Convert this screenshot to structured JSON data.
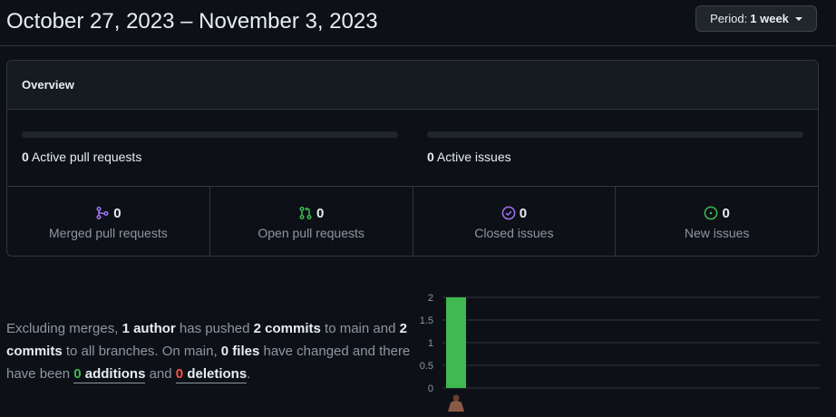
{
  "header": {
    "date_range": "October 27, 2023 – November 3, 2023",
    "period_prefix": "Period:",
    "period_value": "1 week"
  },
  "overview": {
    "title": "Overview",
    "active_pull_requests": {
      "count": "0",
      "label": "Active pull requests"
    },
    "active_issues": {
      "count": "0",
      "label": "Active issues"
    },
    "stats": [
      {
        "count": "0",
        "label": "Merged pull requests",
        "icon": "git-merge-icon",
        "color": "#a371f7"
      },
      {
        "count": "0",
        "label": "Open pull requests",
        "icon": "git-pull-request-icon",
        "color": "#3fb950"
      },
      {
        "count": "0",
        "label": "Closed issues",
        "icon": "issue-closed-icon",
        "color": "#a371f7"
      },
      {
        "count": "0",
        "label": "New issues",
        "icon": "issue-opened-icon",
        "color": "#3fb950"
      }
    ]
  },
  "summary": {
    "p1": "Excluding merges, ",
    "authors": "1 author",
    "p2": " has pushed ",
    "commits_main": "2 commits",
    "p3": " to main and ",
    "commits_all": "2 commits",
    "p4": " to all branches. On main, ",
    "files": "0 files",
    "p5": " have changed and there have been ",
    "additions_num": "0",
    "additions_word": "additions",
    "p6": " and ",
    "deletions_num": "0",
    "deletions_word": "deletions",
    "p7": "."
  },
  "chart_data": {
    "type": "bar",
    "categories": [
      "author-1"
    ],
    "values": [
      2
    ],
    "ylim": [
      0,
      2
    ],
    "yticks": [
      "0",
      "0.5",
      "1",
      "1.5",
      "2"
    ],
    "bar_color": "#3fb950",
    "grid": true
  },
  "colors": {
    "background": "#0d1117",
    "border": "#30363d",
    "text": "#e6edf3",
    "muted": "#8d96a0",
    "green": "#3fb950",
    "red": "#f85149",
    "purple": "#a371f7"
  }
}
